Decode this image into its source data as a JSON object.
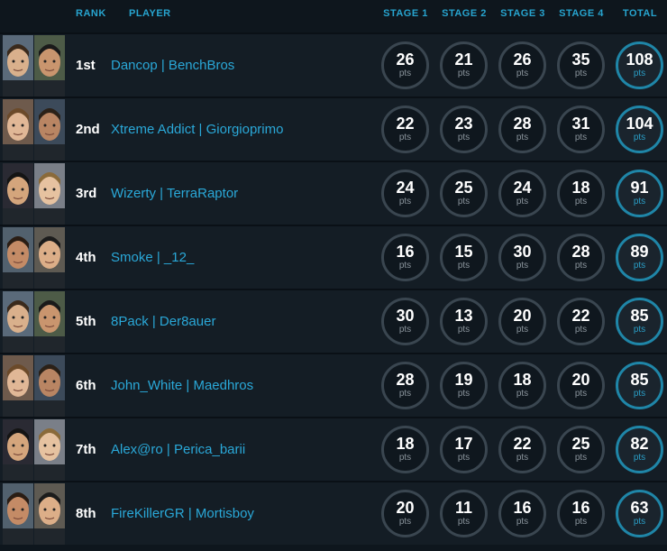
{
  "header": {
    "rank": "RANK",
    "player": "PLAYER",
    "stage1": "STAGE 1",
    "stage2": "STAGE 2",
    "stage3": "STAGE 3",
    "stage4": "STAGE 4",
    "total": "TOTAL"
  },
  "pts_label": "pts",
  "rows": [
    {
      "rank": "1st",
      "player": "Dancop | BenchBros",
      "s1": "26",
      "s2": "21",
      "s3": "26",
      "s4": "35",
      "total": "108"
    },
    {
      "rank": "2nd",
      "player": "Xtreme Addict | Giorgioprimo",
      "s1": "22",
      "s2": "23",
      "s3": "28",
      "s4": "31",
      "total": "104"
    },
    {
      "rank": "3rd",
      "player": "Wizerty | TerraRaptor",
      "s1": "24",
      "s2": "25",
      "s3": "24",
      "s4": "18",
      "total": "91"
    },
    {
      "rank": "4th",
      "player": "Smoke | _12_",
      "s1": "16",
      "s2": "15",
      "s3": "30",
      "s4": "28",
      "total": "89"
    },
    {
      "rank": "5th",
      "player": "8Pack | Der8auer",
      "s1": "30",
      "s2": "13",
      "s3": "20",
      "s4": "22",
      "total": "85"
    },
    {
      "rank": "6th",
      "player": "John_White | Maedhros",
      "s1": "28",
      "s2": "19",
      "s3": "18",
      "s4": "20",
      "total": "85"
    },
    {
      "rank": "7th",
      "player": "Alex@ro | Perica_barii",
      "s1": "18",
      "s2": "17",
      "s3": "22",
      "s4": "25",
      "total": "82"
    },
    {
      "rank": "8th",
      "player": "FireKillerGR | Mortisboy",
      "s1": "20",
      "s2": "11",
      "s3": "16",
      "s4": "16",
      "total": "63"
    }
  ],
  "colors": {
    "accent": "#27a4cf",
    "player_link": "#2aa8d8",
    "row_bg": "#141d25",
    "page_bg": "#0e161d",
    "total_ring": "#1f86a8"
  }
}
